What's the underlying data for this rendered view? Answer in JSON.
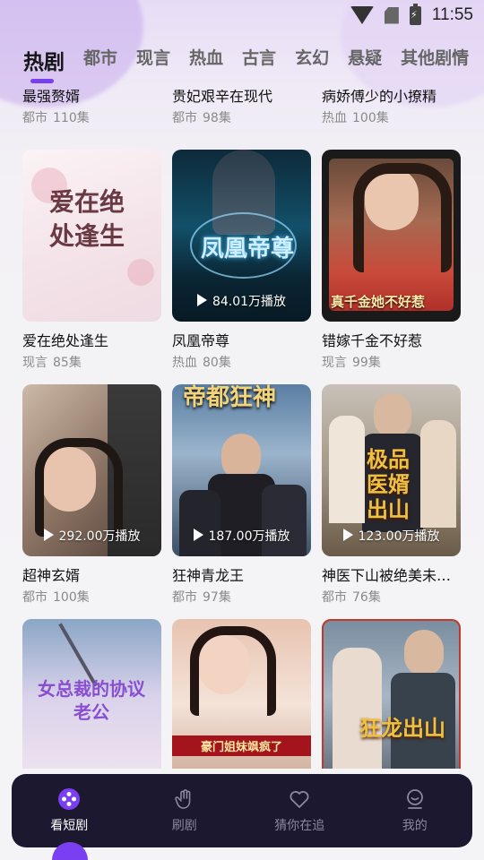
{
  "status_bar": {
    "time": "11:55"
  },
  "tabs": [
    "热剧",
    "都市",
    "现言",
    "热血",
    "古言",
    "玄幻",
    "悬疑",
    "其他剧情"
  ],
  "active_tab": "热剧",
  "partial_row": [
    {
      "title": "最强赘婿",
      "genre": "都市",
      "episodes": "110集"
    },
    {
      "title": "贵妃艰辛在现代",
      "genre": "都市",
      "episodes": "98集"
    },
    {
      "title": "病娇傅少的小撩精",
      "genre": "热血",
      "episodes": "100集"
    }
  ],
  "dramas": [
    {
      "title": "爱在绝处逢生",
      "genre": "现言",
      "episodes": "85集",
      "plays": "",
      "poster_text": "爱在绝处逢生"
    },
    {
      "title": "凤凰帝尊",
      "genre": "热血",
      "episodes": "80集",
      "plays": "84.01万播放",
      "poster_text": "凤凰帝尊"
    },
    {
      "title": "错嫁千金不好惹",
      "genre": "现言",
      "episodes": "99集",
      "plays": "",
      "poster_text": "真千金她不好惹"
    },
    {
      "title": "超神玄婿",
      "genre": "都市",
      "episodes": "100集",
      "plays": "292.00万播放",
      "poster_text": ""
    },
    {
      "title": "狂神青龙王",
      "genre": "都市",
      "episodes": "97集",
      "plays": "187.00万播放",
      "poster_text": "帝都狂神"
    },
    {
      "title": "神医下山被绝美未婚妻",
      "genre": "都市",
      "episodes": "76集",
      "plays": "123.00万播放",
      "poster_text": "极品医婿出山"
    },
    {
      "title": "",
      "genre": "",
      "episodes": "",
      "plays": "",
      "poster_text": "女总裁的协议老公"
    },
    {
      "title": "",
      "genre": "",
      "episodes": "",
      "plays": "",
      "poster_text": "豪门姐妹飒疯了"
    },
    {
      "title": "",
      "genre": "",
      "episodes": "",
      "plays": "",
      "poster_text": "狂龙出山"
    }
  ],
  "bottom_nav": [
    {
      "label": "看短剧",
      "icon": "film-reel-icon",
      "active": true
    },
    {
      "label": "刷剧",
      "icon": "swipe-hand-icon",
      "active": false
    },
    {
      "label": "猜你在追",
      "icon": "heart-icon",
      "active": false
    },
    {
      "label": "我的",
      "icon": "profile-icon",
      "active": false
    }
  ],
  "colors": {
    "accent": "#7b3ff2",
    "nav_bg": "#1b1830"
  }
}
